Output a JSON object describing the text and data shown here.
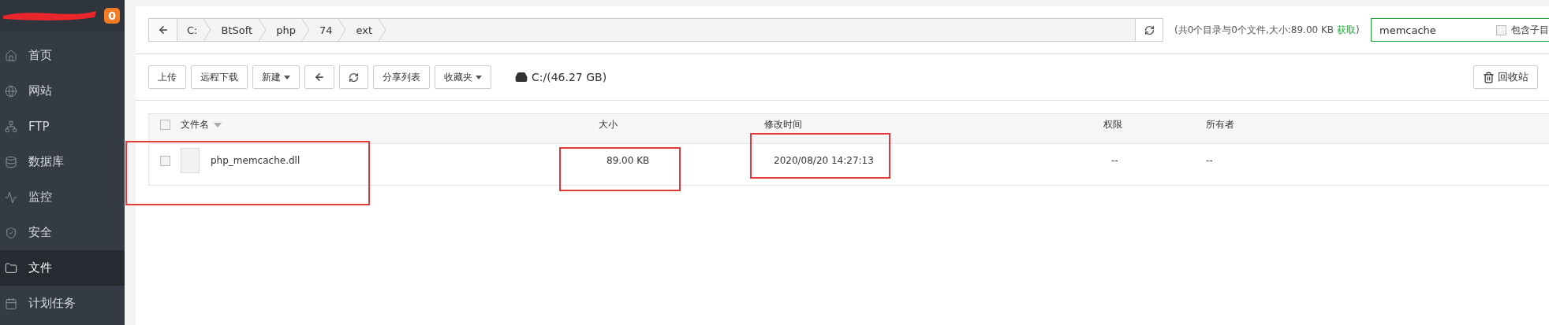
{
  "sidebar": {
    "badge": "0",
    "items": [
      {
        "label": "首页",
        "selected": false
      },
      {
        "label": "网站",
        "selected": false
      },
      {
        "label": "FTP",
        "selected": false
      },
      {
        "label": "数据库",
        "selected": false
      },
      {
        "label": "监控",
        "selected": false
      },
      {
        "label": "安全",
        "selected": false
      },
      {
        "label": "文件",
        "selected": true
      },
      {
        "label": "计划任务",
        "selected": false
      }
    ]
  },
  "breadcrumb": {
    "segments": [
      "C:",
      "BtSoft",
      "php",
      "74",
      "ext"
    ]
  },
  "summary": {
    "text": "(共0个目录与0个文件,大小:89.00 KB",
    "link": "获取",
    "close": ")"
  },
  "search": {
    "value": "memcache",
    "option": {
      "label": "包含子目",
      "checked": false
    }
  },
  "toolbar": {
    "buttons": [
      {
        "kind": "text",
        "label": "上传"
      },
      {
        "kind": "text",
        "label": "远程下载"
      },
      {
        "kind": "dropdown",
        "label": "新建"
      },
      {
        "kind": "back"
      },
      {
        "kind": "refresh"
      },
      {
        "kind": "text",
        "label": "分享列表"
      },
      {
        "kind": "dropdown",
        "label": "收藏夹"
      }
    ],
    "disk": "C:/(46.27 GB)",
    "recycle": "回收站"
  },
  "table": {
    "all_checked": false,
    "columns": [
      {
        "label": "文件名",
        "sortable": true,
        "annotated": true
      },
      {
        "label": "大小",
        "sortable": false,
        "annotated": true
      },
      {
        "label": "修改时间",
        "sortable": false,
        "annotated": true
      },
      {
        "label": "权限",
        "sortable": false,
        "annotated": false
      },
      {
        "label": "所有者",
        "sortable": false,
        "annotated": false
      }
    ],
    "rows": [
      {
        "checked": false,
        "cells": [
          "php_memcache.dll",
          "89.00 KB",
          "2020/08/20 14:27:13",
          "--",
          "--"
        ]
      }
    ]
  }
}
